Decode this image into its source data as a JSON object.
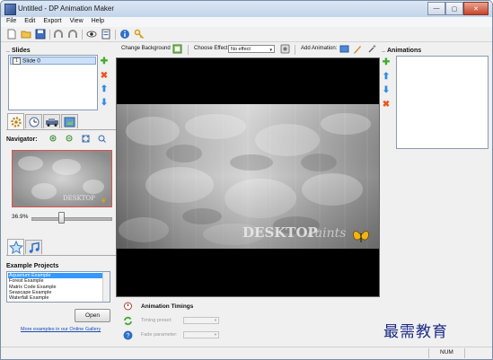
{
  "window": {
    "title": "Untitled - DP Animation Maker",
    "buttons": {
      "minimize": "—",
      "maximize": "▢",
      "close": "✕"
    }
  },
  "menu": {
    "items": [
      "File",
      "Edit",
      "Export",
      "View",
      "Help"
    ]
  },
  "toolbar": {
    "icons": [
      "new-file-icon",
      "open-folder-icon",
      "save-icon",
      "undo-icon",
      "redo-icon",
      "preview-eye-icon",
      "export-icon",
      "info-icon",
      "key-icon"
    ]
  },
  "slides": {
    "title": "Slides",
    "items": [
      {
        "number": "1",
        "label": "Slide 0"
      }
    ]
  },
  "navigator": {
    "label": "Navigator:",
    "zoom": "36.9%"
  },
  "examples": {
    "label": "Example Projects",
    "items": [
      "Aquarium Example",
      "Forest Example",
      "Matrix Code Example",
      "Seascape Example",
      "Waterfall Example"
    ],
    "selected_index": 0,
    "open_label": "Open",
    "more_link": "More examples in our Online Gallery"
  },
  "canvas_toolbar": {
    "change_background": "Change Background",
    "choose_effect": "Choose Effect:",
    "effect_value": "No effect",
    "add_animation": "Add Animation:"
  },
  "canvas": {
    "watermark": "DESKTOP",
    "watermark_script": "Paints"
  },
  "timings": {
    "title": "Animation Timings",
    "timing_preset_label": "Timing preset:",
    "fade_parameter_label": "Fade parameter:"
  },
  "animations": {
    "title": "Animations"
  },
  "status": {
    "num": "NUM"
  },
  "page_watermark": "最需教育",
  "colors": {
    "accent_blue": "#3399ff",
    "add_green": "#3fae2a",
    "delete_orange": "#e8581f",
    "arrow_blue": "#2f8de4"
  }
}
